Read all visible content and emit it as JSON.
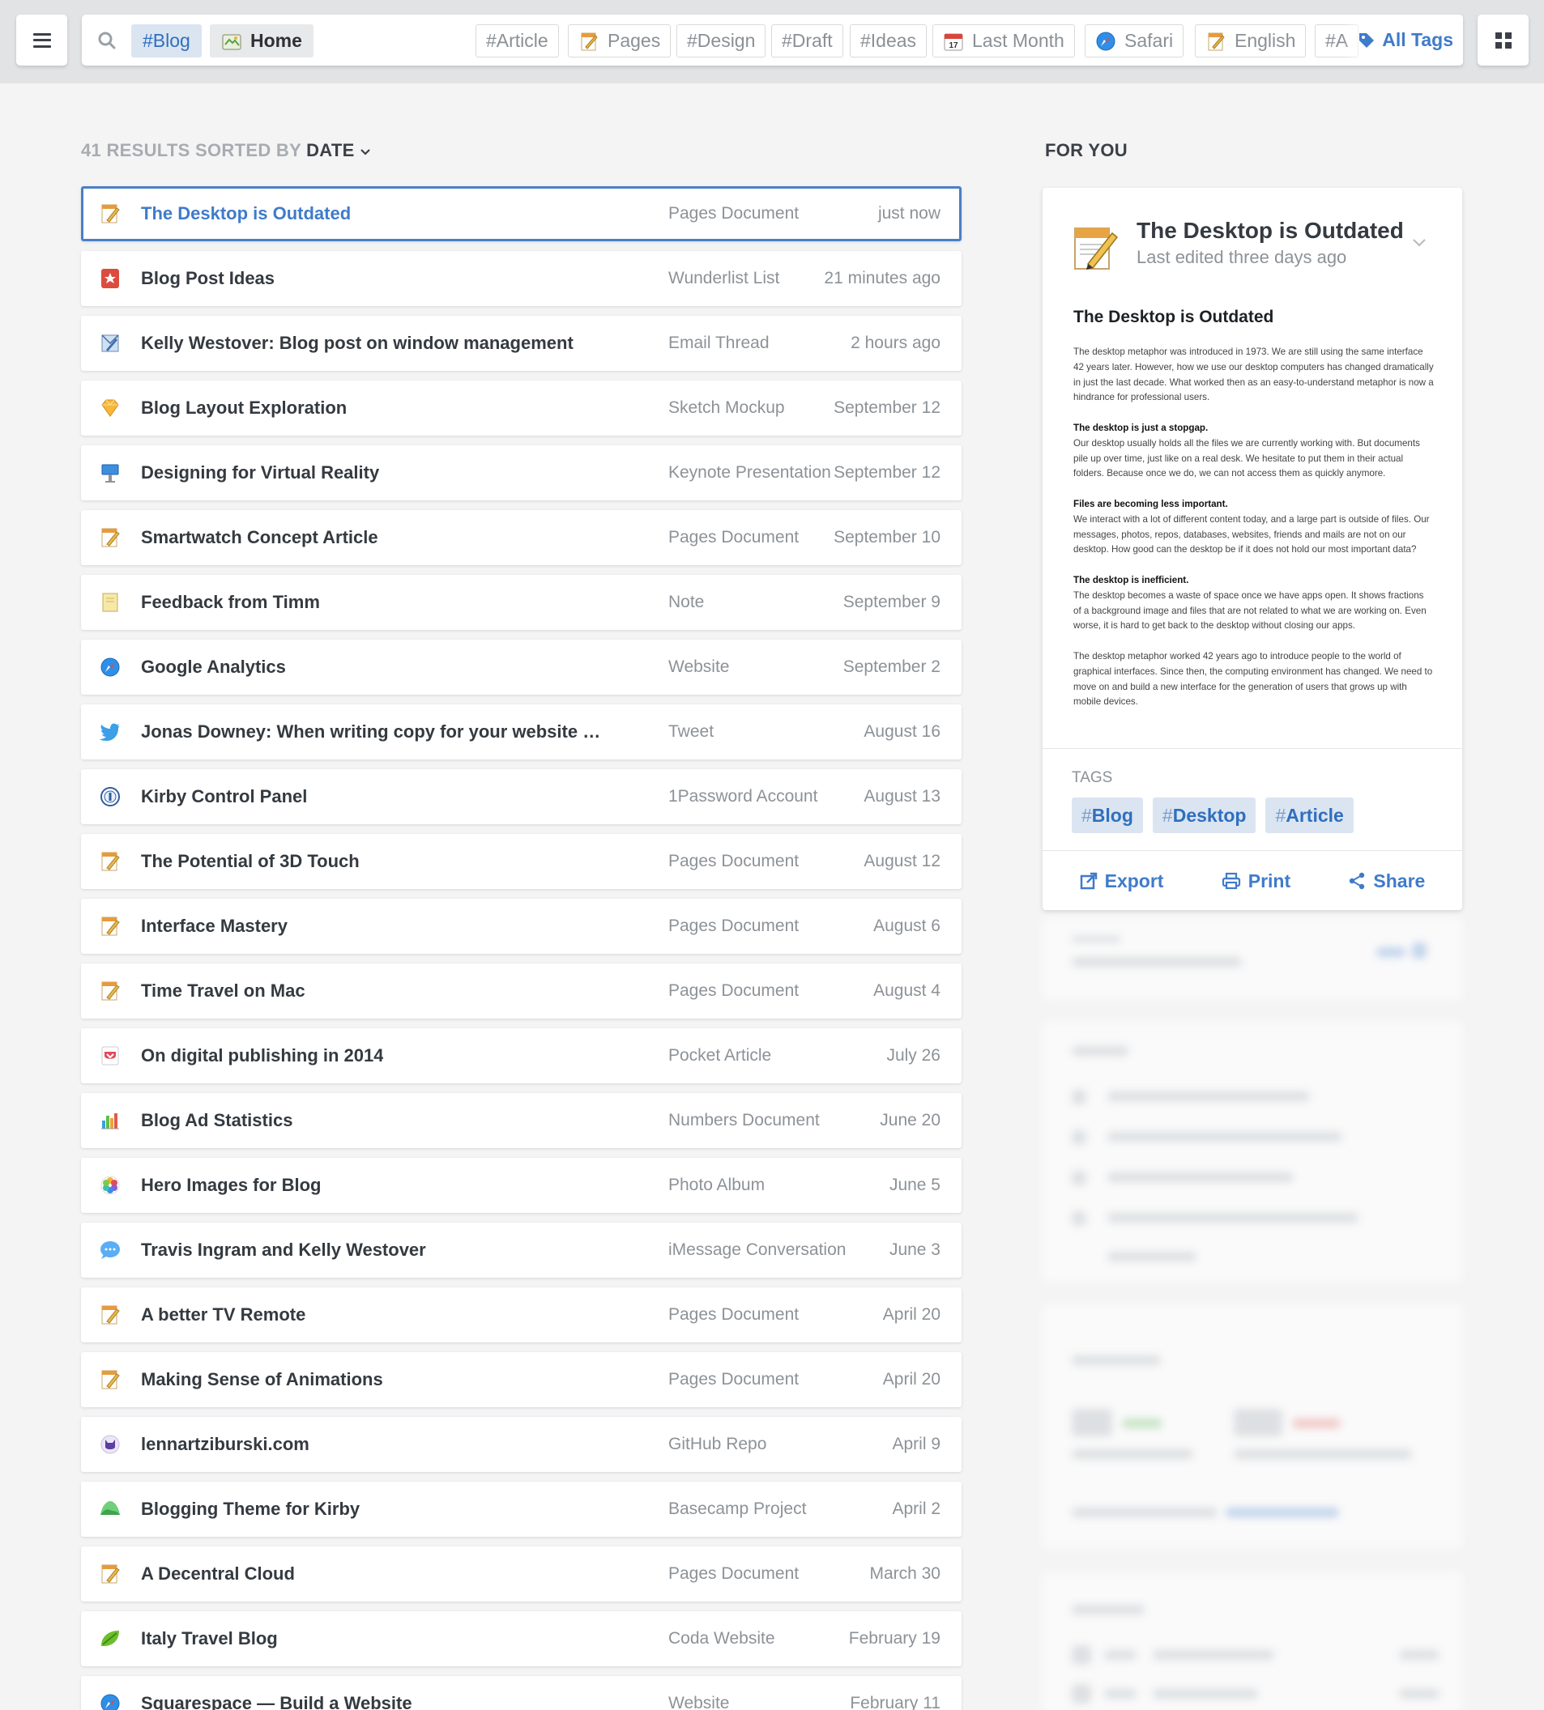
{
  "toolbar": {
    "search_chips": [
      {
        "label": "#Blog"
      },
      {
        "label": "Home"
      },
      {
        "label": "#Article"
      },
      {
        "label": "Pages"
      },
      {
        "label": "#Design"
      },
      {
        "label": "#Draft"
      },
      {
        "label": "#Ideas"
      },
      {
        "label": "Last Month"
      },
      {
        "label": "Safari"
      },
      {
        "label": "English"
      },
      {
        "label": "#A"
      }
    ],
    "calendar_day": "17",
    "all_tags_label": "All Tags"
  },
  "results": {
    "count_label": "41 RESULTS SORTED BY",
    "sort_label": "DATE",
    "items": [
      {
        "title": "The Desktop is Outdated",
        "type": "Pages Document",
        "date": "just now",
        "icon": "pages-icon"
      },
      {
        "title": "Blog Post Ideas",
        "type": "Wunderlist List",
        "date": "21 minutes ago",
        "icon": "wunderlist-icon"
      },
      {
        "title": "Kelly Westover: Blog post on window management",
        "type": "Email Thread",
        "date": "2 hours ago",
        "icon": "mail-icon"
      },
      {
        "title": "Blog Layout Exploration",
        "type": "Sketch Mockup",
        "date": "September 12",
        "icon": "sketch-icon"
      },
      {
        "title": "Designing for Virtual Reality",
        "type": "Keynote Presentation",
        "date": "September 12",
        "icon": "keynote-icon"
      },
      {
        "title": "Smartwatch Concept Article",
        "type": "Pages Document",
        "date": "September 10",
        "icon": "pages-icon"
      },
      {
        "title": "Feedback from Timm",
        "type": "Note",
        "date": "September 9",
        "icon": "note-icon"
      },
      {
        "title": "Google Analytics",
        "type": "Website",
        "date": "September 2",
        "icon": "safari-icon"
      },
      {
        "title": "Jonas Downey: When writing copy for your website or app, …",
        "type": "Tweet",
        "date": "August 16",
        "icon": "twitter-icon"
      },
      {
        "title": "Kirby Control Panel",
        "type": "1Password Account",
        "date": "August 13",
        "icon": "1password-icon"
      },
      {
        "title": "The Potential of 3D Touch",
        "type": "Pages Document",
        "date": "August 12",
        "icon": "pages-icon"
      },
      {
        "title": "Interface Mastery",
        "type": "Pages Document",
        "date": "August 6",
        "icon": "pages-icon"
      },
      {
        "title": "Time Travel on Mac",
        "type": "Pages Document",
        "date": "August 4",
        "icon": "pages-icon"
      },
      {
        "title": "On digital publishing in 2014",
        "type": "Pocket Article",
        "date": "July 26",
        "icon": "pocket-icon"
      },
      {
        "title": "Blog Ad Statistics",
        "type": "Numbers Document",
        "date": "June 20",
        "icon": "numbers-icon"
      },
      {
        "title": "Hero Images for Blog",
        "type": "Photo Album",
        "date": "June 5",
        "icon": "photos-icon"
      },
      {
        "title": "Travis Ingram and Kelly Westover",
        "type": "iMessage Conversation",
        "date": "June 3",
        "icon": "messages-icon"
      },
      {
        "title": "A better TV Remote",
        "type": "Pages Document",
        "date": "April 20",
        "icon": "pages-icon"
      },
      {
        "title": "Making Sense of Animations",
        "type": "Pages Document",
        "date": "April 20",
        "icon": "pages-icon"
      },
      {
        "title": "lennartziburski.com",
        "type": "GitHub Repo",
        "date": "April 9",
        "icon": "github-icon"
      },
      {
        "title": "Blogging Theme for Kirby",
        "type": "Basecamp Project",
        "date": "April 2",
        "icon": "basecamp-icon"
      },
      {
        "title": "A Decentral Cloud",
        "type": "Pages Document",
        "date": "March 30",
        "icon": "pages-icon"
      },
      {
        "title": "Italy Travel Blog",
        "type": "Coda Website",
        "date": "February 19",
        "icon": "coda-icon"
      },
      {
        "title": "Squarespace — Build a Website",
        "type": "Website",
        "date": "February 11",
        "icon": "safari-icon"
      }
    ]
  },
  "for_you": {
    "heading": "FOR YOU",
    "title": "The Desktop is Outdated",
    "subtitle": "Last edited three days ago",
    "doc": {
      "heading": "The Desktop is Outdated",
      "intro": "The desktop metaphor was introduced in 1973. We are still using the same interface 42 years later. However, how we use our desktop computers has changed dramatically in just the last decade. What worked then as an easy-to-understand metaphor is now a hindrance for professional users.",
      "sections": [
        {
          "heading": "The desktop is just a stopgap.",
          "text": "Our desktop usually holds all the files we are currently working with. But documents pile up over time, just like on a real desk. We hesitate to put them in their actual folders. Because once we do, we can not access them as quickly anymore."
        },
        {
          "heading": "Files are becoming less important.",
          "text": "We interact with a lot of different content today, and a large part is outside of files. Our messages, photos, repos, databases, websites, friends and mails are not on our desktop. How good can the desktop be if it does not hold our most important data?"
        },
        {
          "heading": "The desktop is inefficient.",
          "text": "The desktop becomes a waste of space once we have apps open. It shows fractions of a background image and files that are not related to what we are working on. Even worse, it is hard to get back to the desktop without closing our apps."
        }
      ],
      "outro": "The desktop metaphor worked 42 years ago to introduce people to the world of graphical interfaces. Since then, the computing environment has changed. We need to move on and build a new interface for the generation of users that grows up with mobile devices."
    },
    "tags_label": "TAGS",
    "tags": [
      "Blog",
      "Desktop",
      "Article"
    ],
    "actions": {
      "export": "Export",
      "print": "Print",
      "share": "Share"
    }
  },
  "colors": {
    "accent": "#3f7bc9",
    "chip_bg": "#dbe5f1",
    "background": "#f4f4f5"
  }
}
